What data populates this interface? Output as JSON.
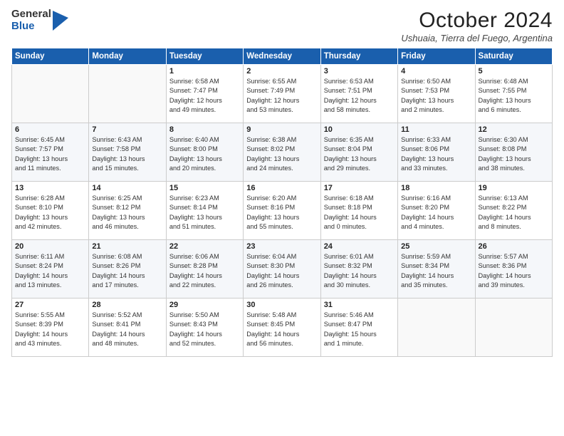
{
  "header": {
    "logo_line1": "General",
    "logo_line2": "Blue",
    "month": "October 2024",
    "location": "Ushuaia, Tierra del Fuego, Argentina"
  },
  "weekdays": [
    "Sunday",
    "Monday",
    "Tuesday",
    "Wednesday",
    "Thursday",
    "Friday",
    "Saturday"
  ],
  "weeks": [
    [
      {
        "day": "",
        "info": ""
      },
      {
        "day": "",
        "info": ""
      },
      {
        "day": "1",
        "info": "Sunrise: 6:58 AM\nSunset: 7:47 PM\nDaylight: 12 hours\nand 49 minutes."
      },
      {
        "day": "2",
        "info": "Sunrise: 6:55 AM\nSunset: 7:49 PM\nDaylight: 12 hours\nand 53 minutes."
      },
      {
        "day": "3",
        "info": "Sunrise: 6:53 AM\nSunset: 7:51 PM\nDaylight: 12 hours\nand 58 minutes."
      },
      {
        "day": "4",
        "info": "Sunrise: 6:50 AM\nSunset: 7:53 PM\nDaylight: 13 hours\nand 2 minutes."
      },
      {
        "day": "5",
        "info": "Sunrise: 6:48 AM\nSunset: 7:55 PM\nDaylight: 13 hours\nand 6 minutes."
      }
    ],
    [
      {
        "day": "6",
        "info": "Sunrise: 6:45 AM\nSunset: 7:57 PM\nDaylight: 13 hours\nand 11 minutes."
      },
      {
        "day": "7",
        "info": "Sunrise: 6:43 AM\nSunset: 7:58 PM\nDaylight: 13 hours\nand 15 minutes."
      },
      {
        "day": "8",
        "info": "Sunrise: 6:40 AM\nSunset: 8:00 PM\nDaylight: 13 hours\nand 20 minutes."
      },
      {
        "day": "9",
        "info": "Sunrise: 6:38 AM\nSunset: 8:02 PM\nDaylight: 13 hours\nand 24 minutes."
      },
      {
        "day": "10",
        "info": "Sunrise: 6:35 AM\nSunset: 8:04 PM\nDaylight: 13 hours\nand 29 minutes."
      },
      {
        "day": "11",
        "info": "Sunrise: 6:33 AM\nSunset: 8:06 PM\nDaylight: 13 hours\nand 33 minutes."
      },
      {
        "day": "12",
        "info": "Sunrise: 6:30 AM\nSunset: 8:08 PM\nDaylight: 13 hours\nand 38 minutes."
      }
    ],
    [
      {
        "day": "13",
        "info": "Sunrise: 6:28 AM\nSunset: 8:10 PM\nDaylight: 13 hours\nand 42 minutes."
      },
      {
        "day": "14",
        "info": "Sunrise: 6:25 AM\nSunset: 8:12 PM\nDaylight: 13 hours\nand 46 minutes."
      },
      {
        "day": "15",
        "info": "Sunrise: 6:23 AM\nSunset: 8:14 PM\nDaylight: 13 hours\nand 51 minutes."
      },
      {
        "day": "16",
        "info": "Sunrise: 6:20 AM\nSunset: 8:16 PM\nDaylight: 13 hours\nand 55 minutes."
      },
      {
        "day": "17",
        "info": "Sunrise: 6:18 AM\nSunset: 8:18 PM\nDaylight: 14 hours\nand 0 minutes."
      },
      {
        "day": "18",
        "info": "Sunrise: 6:16 AM\nSunset: 8:20 PM\nDaylight: 14 hours\nand 4 minutes."
      },
      {
        "day": "19",
        "info": "Sunrise: 6:13 AM\nSunset: 8:22 PM\nDaylight: 14 hours\nand 8 minutes."
      }
    ],
    [
      {
        "day": "20",
        "info": "Sunrise: 6:11 AM\nSunset: 8:24 PM\nDaylight: 14 hours\nand 13 minutes."
      },
      {
        "day": "21",
        "info": "Sunrise: 6:08 AM\nSunset: 8:26 PM\nDaylight: 14 hours\nand 17 minutes."
      },
      {
        "day": "22",
        "info": "Sunrise: 6:06 AM\nSunset: 8:28 PM\nDaylight: 14 hours\nand 22 minutes."
      },
      {
        "day": "23",
        "info": "Sunrise: 6:04 AM\nSunset: 8:30 PM\nDaylight: 14 hours\nand 26 minutes."
      },
      {
        "day": "24",
        "info": "Sunrise: 6:01 AM\nSunset: 8:32 PM\nDaylight: 14 hours\nand 30 minutes."
      },
      {
        "day": "25",
        "info": "Sunrise: 5:59 AM\nSunset: 8:34 PM\nDaylight: 14 hours\nand 35 minutes."
      },
      {
        "day": "26",
        "info": "Sunrise: 5:57 AM\nSunset: 8:36 PM\nDaylight: 14 hours\nand 39 minutes."
      }
    ],
    [
      {
        "day": "27",
        "info": "Sunrise: 5:55 AM\nSunset: 8:39 PM\nDaylight: 14 hours\nand 43 minutes."
      },
      {
        "day": "28",
        "info": "Sunrise: 5:52 AM\nSunset: 8:41 PM\nDaylight: 14 hours\nand 48 minutes."
      },
      {
        "day": "29",
        "info": "Sunrise: 5:50 AM\nSunset: 8:43 PM\nDaylight: 14 hours\nand 52 minutes."
      },
      {
        "day": "30",
        "info": "Sunrise: 5:48 AM\nSunset: 8:45 PM\nDaylight: 14 hours\nand 56 minutes."
      },
      {
        "day": "31",
        "info": "Sunrise: 5:46 AM\nSunset: 8:47 PM\nDaylight: 15 hours\nand 1 minute."
      },
      {
        "day": "",
        "info": ""
      },
      {
        "day": "",
        "info": ""
      }
    ]
  ]
}
